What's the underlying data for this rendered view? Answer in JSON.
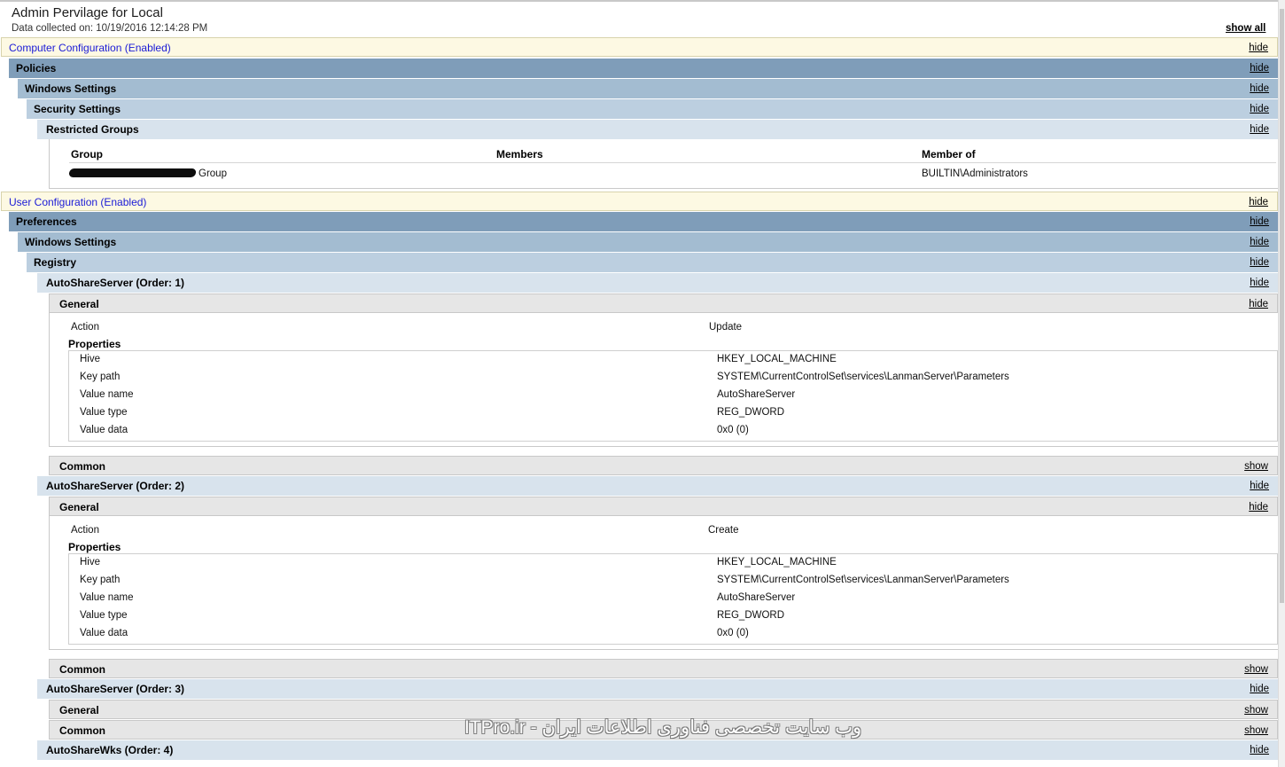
{
  "page": {
    "title": "Admin Pervilage for Local",
    "data_collected": "Data collected on: 10/19/2016 12:14:28 PM",
    "show_all": "show all"
  },
  "computer_config": {
    "label": "Computer Configuration (Enabled)",
    "toggle": "hide",
    "policies": {
      "label": "Policies",
      "toggle": "hide"
    },
    "windows_settings": {
      "label": "Windows Settings",
      "toggle": "hide"
    },
    "security_settings": {
      "label": "Security Settings",
      "toggle": "hide"
    },
    "restricted_groups": {
      "label": "Restricted Groups",
      "toggle": "hide",
      "columns": [
        "Group",
        "Members",
        "Member of"
      ],
      "rows": [
        {
          "group": "Group",
          "members": "",
          "member_of": "BUILTIN\\Administrators"
        }
      ]
    }
  },
  "user_config": {
    "label": "User Configuration (Enabled)",
    "toggle": "hide",
    "preferences": {
      "label": "Preferences",
      "toggle": "hide"
    },
    "windows_settings": {
      "label": "Windows Settings",
      "toggle": "hide"
    },
    "registry": {
      "label": "Registry",
      "toggle": "hide"
    },
    "items": [
      {
        "label": "AutoShareServer (Order: 1)",
        "toggle": "hide",
        "general": {
          "label": "General",
          "toggle": "hide"
        },
        "action_label": "Action",
        "action_value": "Update",
        "properties_label": "Properties",
        "properties": [
          {
            "name": "Hive",
            "value": "HKEY_LOCAL_MACHINE"
          },
          {
            "name": "Key path",
            "value": "SYSTEM\\CurrentControlSet\\services\\LanmanServer\\Parameters"
          },
          {
            "name": "Value name",
            "value": "AutoShareServer"
          },
          {
            "name": "Value type",
            "value": "REG_DWORD"
          },
          {
            "name": "Value data",
            "value": "0x0 (0)"
          }
        ],
        "common": {
          "label": "Common",
          "toggle": "show"
        }
      },
      {
        "label": "AutoShareServer (Order: 2)",
        "toggle": "hide",
        "general": {
          "label": "General",
          "toggle": "hide"
        },
        "action_label": "Action",
        "action_value": "Create",
        "properties_label": "Properties",
        "properties": [
          {
            "name": "Hive",
            "value": "HKEY_LOCAL_MACHINE"
          },
          {
            "name": "Key path",
            "value": "SYSTEM\\CurrentControlSet\\services\\LanmanServer\\Parameters"
          },
          {
            "name": "Value name",
            "value": "AutoShareServer"
          },
          {
            "name": "Value type",
            "value": "REG_DWORD"
          },
          {
            "name": "Value data",
            "value": "0x0 (0)"
          }
        ],
        "common": {
          "label": "Common",
          "toggle": "show"
        }
      },
      {
        "label": "AutoShareServer (Order: 3)",
        "toggle": "hide",
        "general": {
          "label": "General",
          "toggle": "show"
        },
        "common": {
          "label": "Common",
          "toggle": "show"
        }
      },
      {
        "label": "AutoShareWks (Order: 4)",
        "toggle": "hide"
      }
    ]
  },
  "watermark": "ITPro.ir - وب سایت تخصصی فناوری اطلاعات ایران"
}
